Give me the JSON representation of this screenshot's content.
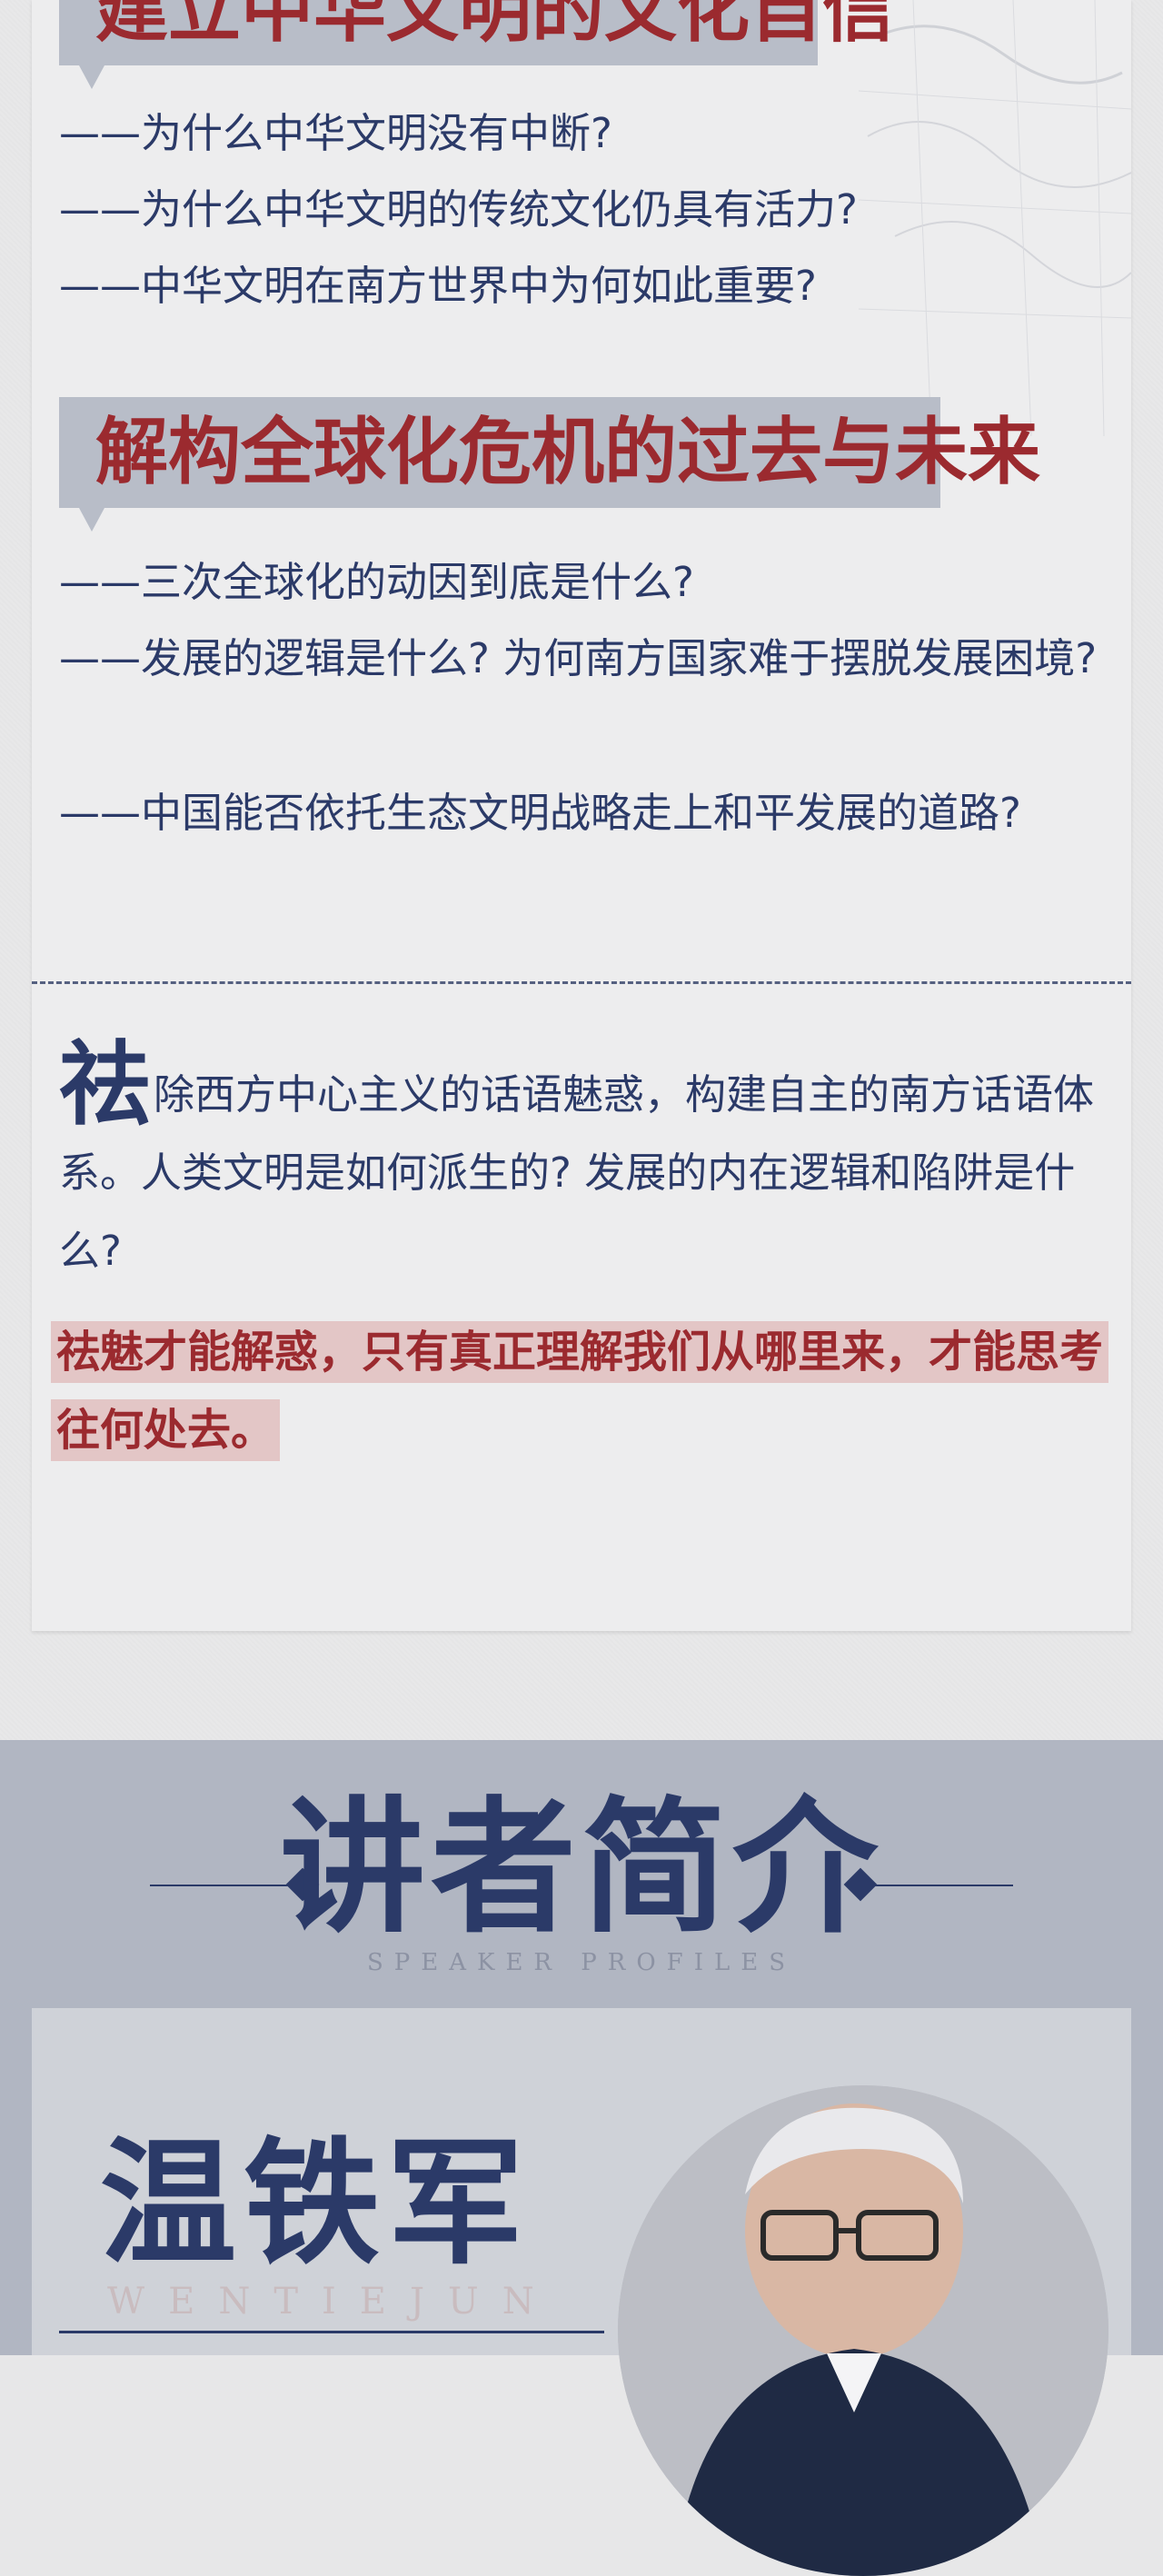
{
  "section1": {
    "heading": "建立中华文明的文化自信",
    "questions": [
      "——为什么中华文明没有中断?",
      "——为什么中华文明的传统文化仍具有活力?",
      "——中华文明在南方世界中为何如此重要?"
    ]
  },
  "section2": {
    "heading": "解构全球化危机的过去与未来",
    "questions": [
      "——三次全球化的动因到底是什么?",
      "——发展的逻辑是什么? 为何南方国家难于摆脱发展困境?",
      "——中国能否依托生态文明战略走上和平发展的道路?"
    ]
  },
  "intro": {
    "first_char": "祛",
    "text": "除西方中心主义的话语魅惑，构建自主的南方话语体系。人类文明是如何派生的? 发展的内在逻辑和陷阱是什么?",
    "highlight": "祛魅才能解惑，只有真正理解我们从哪里来，才能思考往何处去。"
  },
  "speaker_section": {
    "title": "讲者简介",
    "subtitle": "SPEAKER PROFILES"
  },
  "speaker": {
    "name": "温铁军",
    "pinyin": "WENTIEJUN"
  },
  "colors": {
    "navy": "#2b3a68",
    "red": "#9b2a2f",
    "heading_bg": "#b8bdc8",
    "section_bg": "#b1b6c2"
  }
}
